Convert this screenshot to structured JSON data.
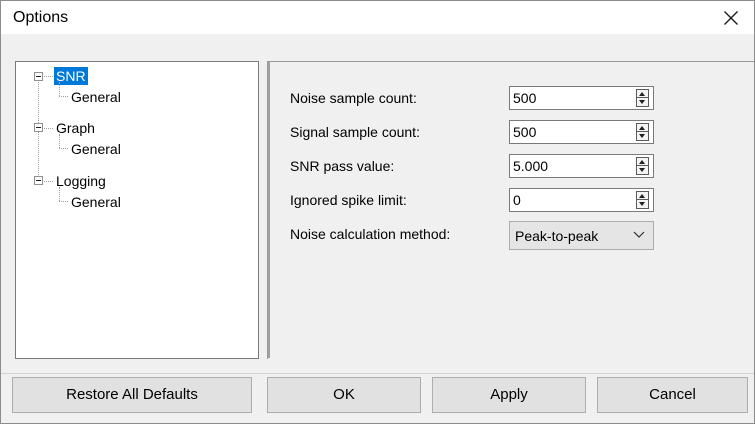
{
  "window": {
    "title": "Options"
  },
  "tree": {
    "nodes": [
      {
        "label": "SNR",
        "child": "General"
      },
      {
        "label": "Graph",
        "child": "General"
      },
      {
        "label": "Logging",
        "child": "General"
      }
    ]
  },
  "settings": {
    "noise_sample_count": {
      "label": "Noise sample count:",
      "value": "500"
    },
    "signal_sample_count": {
      "label": "Signal sample count:",
      "value": "500"
    },
    "snr_pass_value": {
      "label": "SNR pass value:",
      "value": "5.000"
    },
    "ignored_spike_limit": {
      "label": "Ignored spike limit:",
      "value": "0"
    },
    "noise_calc_method": {
      "label": "Noise calculation method:",
      "selected": "Peak-to-peak"
    }
  },
  "buttons": {
    "restore": "Restore All Defaults",
    "ok": "OK",
    "apply": "Apply",
    "cancel": "Cancel"
  },
  "colors": {
    "selection": "#0078d7",
    "dialog_bg": "#f0f0f0"
  }
}
